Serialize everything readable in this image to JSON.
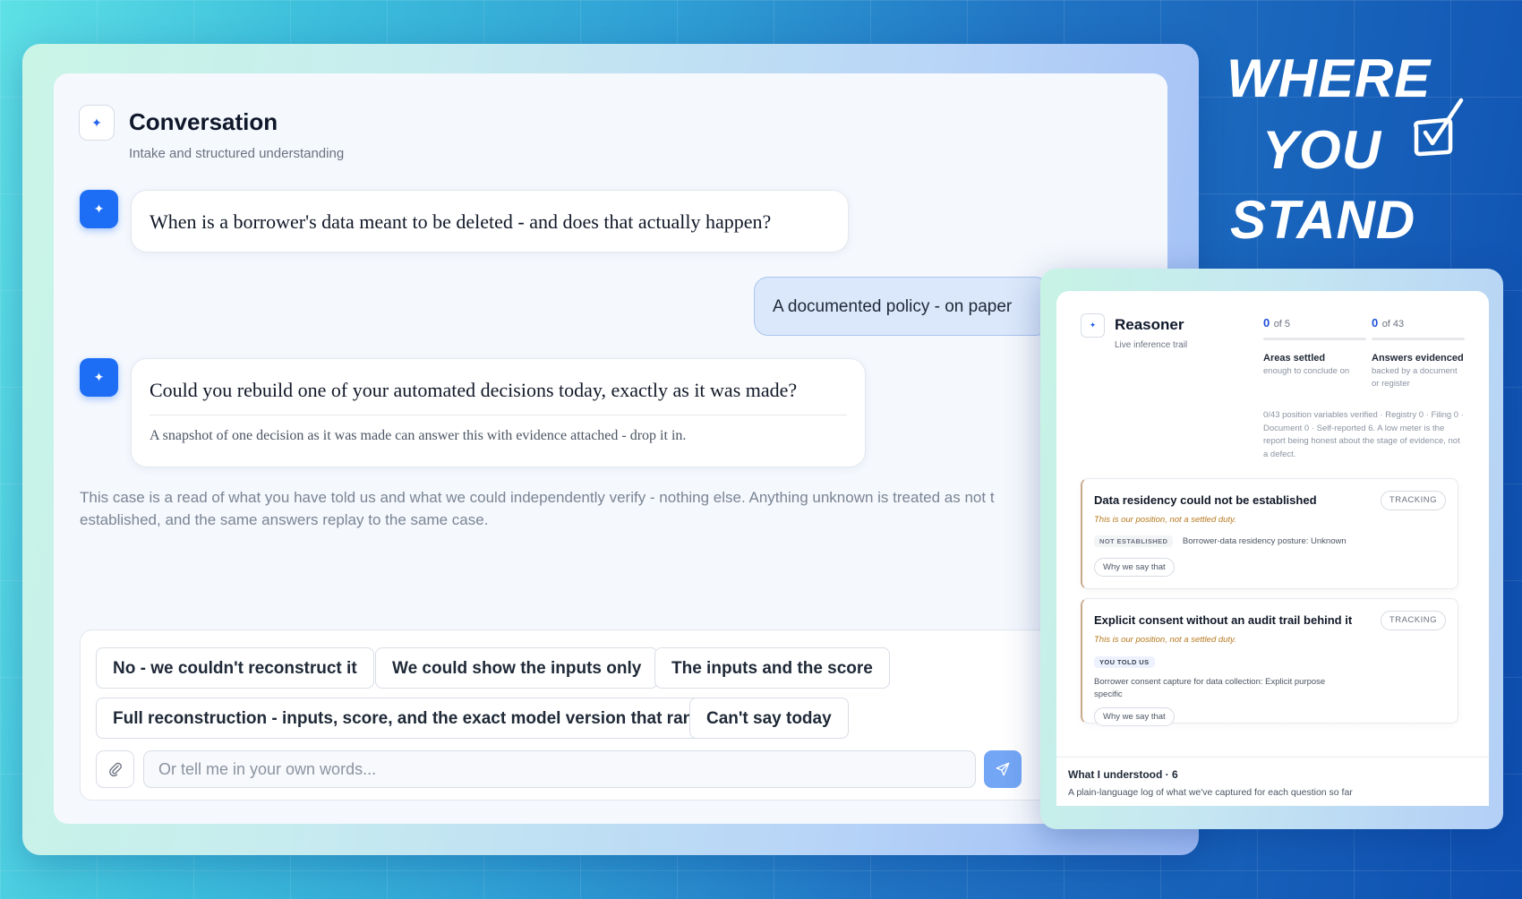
{
  "headline": {
    "line1": "WHERE",
    "line2": "YOU",
    "line3": "STAND"
  },
  "conversation": {
    "title": "Conversation",
    "subtitle": "Intake and structured understanding",
    "question1": "When is a borrower's data meant to be deleted - and does that actually happen?",
    "user_answer": "A documented policy - on paper",
    "question2": "Could you rebuild one of your automated decisions today, exactly as it was made?",
    "question2_hint": "A snapshot of one decision as it was made can answer this with evidence attached - drop it in.",
    "disclaimer": "This case is a read of what you have told us and what we could independently verify - nothing else. Anything unknown is treated as not t established, and the same answers replay to the same case.",
    "options": [
      "No - we couldn't reconstruct it",
      "We could show the inputs only",
      "The inputs and the score",
      "Full reconstruction - inputs, score, and the exact model version that ran",
      "Can't say today"
    ],
    "input_placeholder": "Or tell me in your own words..."
  },
  "reasoner": {
    "title": "Reasoner",
    "subtitle": "Live inference trail",
    "stats": [
      {
        "value": "0",
        "of": "of 5",
        "label": "Areas settled",
        "desc": "enough to conclude on"
      },
      {
        "value": "0",
        "of": "of 43",
        "label": "Answers evidenced",
        "desc": "backed by a document or register"
      }
    ],
    "position_note": "0/43 position variables verified · Registry 0 · Filing 0 · Document 0 · Self-reported 6. A low meter is the report being honest about the stage of evidence, not a defect.",
    "cards": [
      {
        "title": "Data residency could not be established",
        "status": "TRACKING",
        "note": "This is our position, not a settled duty.",
        "badge": "NOT ESTABLISHED",
        "detail": "Borrower-data residency posture: Unknown",
        "why": "Why we say that"
      },
      {
        "title": "Explicit consent without an audit trail behind it",
        "status": "TRACKING",
        "note": "This is our position, not a settled duty.",
        "badge": "YOU TOLD US",
        "detail": "Borrower consent capture for data collection: Explicit purpose specific",
        "why": "Why we say that"
      }
    ],
    "understood_title": "What I understood · 6",
    "understood_sub": "A plain-language log of what we've captured for each question so far"
  },
  "colors": {
    "accent": "#1d6ef5",
    "send_button": "#73a6f4",
    "note": "#b7791f"
  },
  "icons": [
    "sparkle-icon",
    "paperclip-icon",
    "send-icon",
    "checkbox-icon"
  ]
}
